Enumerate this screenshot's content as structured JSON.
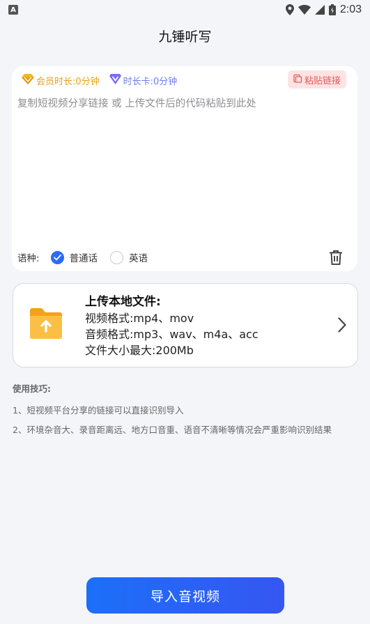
{
  "status_bar": {
    "app_icon_letter": "A",
    "time": "2:03",
    "icons": [
      "location-icon",
      "wifi-icon",
      "signal-icon",
      "battery-icon"
    ]
  },
  "header": {
    "title": "九锤听写"
  },
  "input_card": {
    "member_badge": "会员时长:0分钟",
    "card_badge": "时长卡:0分钟",
    "paste_button": "粘贴链接",
    "placeholder": "复制短视频分享链接 或 上传文件后的代码粘贴到此处",
    "value": "",
    "language": {
      "label": "语种:",
      "options": [
        {
          "label": "普通话",
          "checked": true
        },
        {
          "label": "英语",
          "checked": false
        }
      ]
    }
  },
  "upload_card": {
    "title": "上传本地文件:",
    "video_formats": "视频格式:mp4、mov",
    "audio_formats": "音频格式:mp3、wav、m4a、acc",
    "max_size": "文件大小最大:200Mb"
  },
  "tips": {
    "title": "使用技巧:",
    "items": [
      "1、短视频平台分享的链接可以直接识别导入",
      "2、环境杂音大、录音距离远、地方口音重、语音不清晰等情况会严重影响识别结果"
    ]
  },
  "footer": {
    "import_button": "导入音视频"
  },
  "colors": {
    "accent": "#2b6bf5",
    "member_gold": "#e7a21b",
    "card_purple": "#6e7cf0",
    "paste_red": "#e25c5c",
    "folder_orange": "#f7a823"
  }
}
